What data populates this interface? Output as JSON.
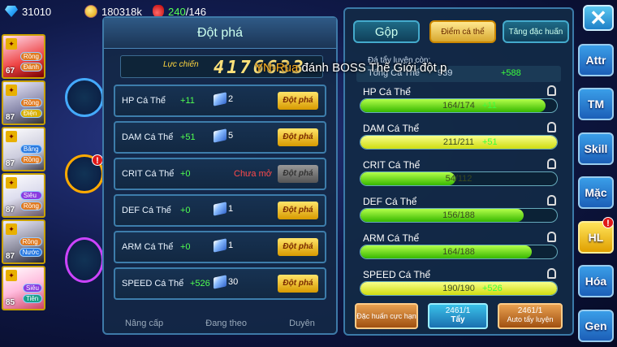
{
  "resources": {
    "gems": "31010",
    "gold": "180318k",
    "energy_current": "240",
    "energy_max": "/146"
  },
  "party": [
    {
      "level": "67",
      "tag1": "Rồng",
      "tag2": "Đánh"
    },
    {
      "level": "87",
      "tag1": "Rồng",
      "tag2": "Điện"
    },
    {
      "level": "87",
      "tag1": "Băng",
      "tag2": "Rồng"
    },
    {
      "level": "87",
      "tag1": "Siêu",
      "tag2": "Rồng"
    },
    {
      "level": "87",
      "tag1": "Rồng",
      "tag2": "Nước"
    },
    {
      "level": "85",
      "tag1": "Siêu",
      "tag2": "Tiên"
    }
  ],
  "notice": {
    "name": "YN-Rùa",
    "text": " đánh BOSS Thế Giới đột p"
  },
  "breakthrough": {
    "title": "Đột phá",
    "power_label": "Lực chiến",
    "power_value": "4176633",
    "rows": [
      {
        "name": "HP Cá Thể",
        "value": "+11",
        "cost": "2",
        "button": "Đột phá"
      },
      {
        "name": "DAM Cá Thể",
        "value": "+51",
        "cost": "5",
        "button": "Đột phá"
      },
      {
        "name": "CRIT Cá Thể",
        "value": "+0",
        "locked": "Chưa mở",
        "button": "Đột phá"
      },
      {
        "name": "DEF Cá Thể",
        "value": "+0",
        "cost": "1",
        "button": "Đột phá"
      },
      {
        "name": "ARM Cá Thể",
        "value": "+0",
        "cost": "1",
        "button": "Đột phá"
      },
      {
        "name": "SPEED Cá Thể",
        "value": "+526",
        "cost": "30",
        "button": "Đột phá"
      }
    ],
    "bottom_tabs": [
      "Nâng cấp",
      "Đang theo",
      "Duyên"
    ]
  },
  "stats_panel": {
    "tabs": [
      "Gộp",
      "Điểm cá thể",
      "Tăng đặc huấn"
    ],
    "remain_label": "Đá tẩy luyện còn:",
    "total_label": "Tổng Cá Thể",
    "total_value": "939",
    "total_bonus": "+588",
    "stats": [
      {
        "name": "HP Cá Thể",
        "current": 164,
        "max": 174,
        "text": "164/174",
        "bonus": "+11"
      },
      {
        "name": "DAM Cá Thể",
        "current": 211,
        "max": 211,
        "text": "211/211",
        "bonus": "+51"
      },
      {
        "name": "CRIT Cá Thể",
        "current": 54,
        "max": 112,
        "text": "54/112",
        "bonus": ""
      },
      {
        "name": "DEF Cá Thể",
        "current": 156,
        "max": 188,
        "text": "156/188",
        "bonus": ""
      },
      {
        "name": "ARM Cá Thể",
        "current": 164,
        "max": 188,
        "text": "164/188",
        "bonus": ""
      },
      {
        "name": "SPEED Cá Thể",
        "current": 190,
        "max": 190,
        "text": "190/190",
        "bonus": "+526"
      }
    ],
    "buttons": {
      "train": "Đặc huấn cực hạn",
      "wash_count": "2461/1",
      "wash": "Tẩy",
      "auto_count": "2461/1",
      "auto": "Auto tẩy luyện"
    }
  },
  "side_menu": [
    "Attr",
    "TM",
    "Skill",
    "Mặc",
    "HL",
    "Hóa",
    "Gen"
  ],
  "badge": "!"
}
